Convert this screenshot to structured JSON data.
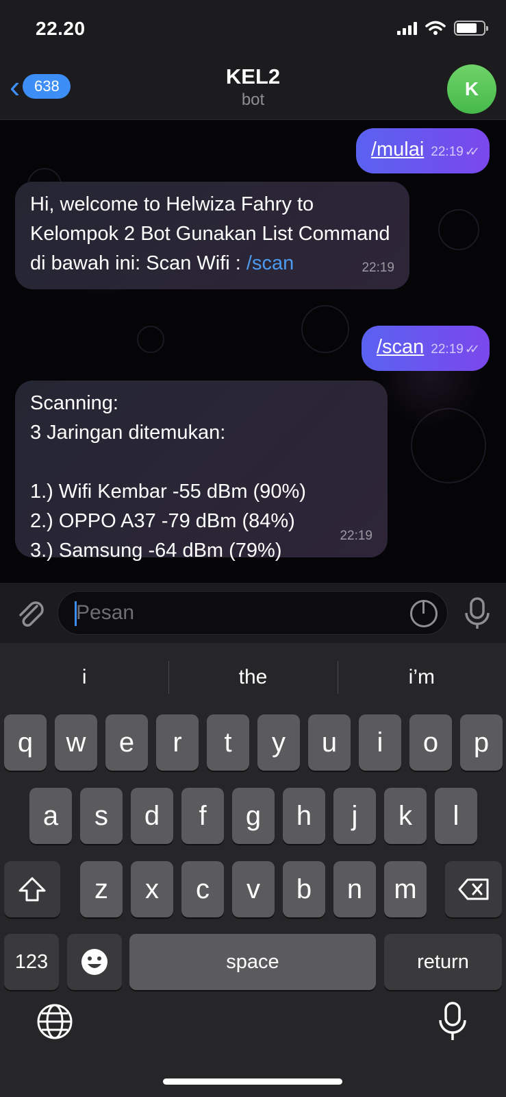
{
  "status": {
    "time": "22.20"
  },
  "header": {
    "back_count": "638",
    "title": "KEL2",
    "subtitle": "bot",
    "avatar_initial": "K"
  },
  "messages": [
    {
      "dir": "out",
      "text": "/mulai",
      "time": "22:19"
    },
    {
      "dir": "in",
      "text": "Hi, welcome to Helwiza Fahry to Kelompok 2 Bot Gunakan List Command di bawah ini: Scan Wifi : ",
      "link": "/scan",
      "time": "22:19"
    },
    {
      "dir": "out",
      "text": "/scan",
      "time": "22:19"
    },
    {
      "dir": "in",
      "lines": [
        "Scanning:",
        "3 Jaringan ditemukan:",
        "",
        "1.) Wifi Kembar -55 dBm (90%)",
        "2.) OPPO A37 -79 dBm (84%)",
        "3.) Samsung -64 dBm (79%)"
      ],
      "time": "22:19"
    }
  ],
  "input": {
    "placeholder": "Pesan"
  },
  "keyboard": {
    "suggestions": [
      "i",
      "the",
      "i’m"
    ],
    "row1": [
      "q",
      "w",
      "e",
      "r",
      "t",
      "y",
      "u",
      "i",
      "o",
      "p"
    ],
    "row2": [
      "a",
      "s",
      "d",
      "f",
      "g",
      "h",
      "j",
      "k",
      "l"
    ],
    "row3": [
      "z",
      "x",
      "c",
      "v",
      "b",
      "n",
      "m"
    ],
    "numbers_label": "123",
    "space_label": "space",
    "return_label": "return"
  },
  "colors": {
    "accent": "#3e8ef7",
    "outgoing_bubble": "#6a55ee",
    "avatar": "#58c55a"
  }
}
